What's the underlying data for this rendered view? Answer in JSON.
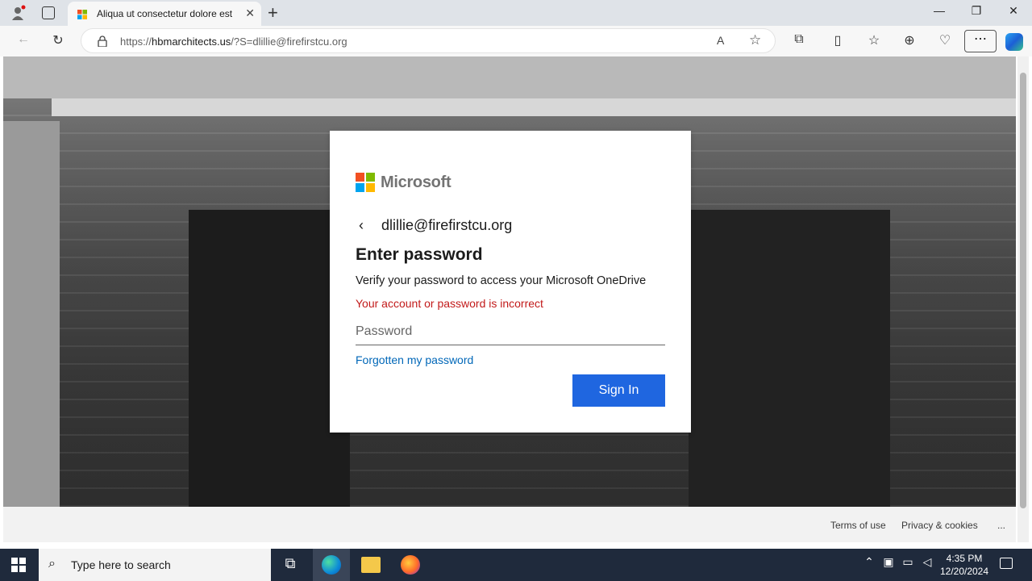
{
  "browser": {
    "tab_title": "Aliqua ut consectetur dolore est",
    "url_prefix": "https://",
    "url_host": "hbmarchitects.us",
    "url_rest": "/?S=dlillie@firefirstcu.org",
    "new_tab": "+",
    "tab_close": "✕",
    "window_controls": {
      "minimize": "—",
      "restore": "❐",
      "close": "✕"
    }
  },
  "dialog": {
    "brand": "Microsoft",
    "back_glyph": "‹",
    "email": "dlillie@firefirstcu.org",
    "heading": "Enter password",
    "description": "Verify your password to access your Microsoft OneDrive",
    "error": "Your account or password is incorrect",
    "password_placeholder": "Password",
    "forgot_link": "Forgotten my password",
    "sign_in": "Sign In"
  },
  "footer": {
    "terms": "Terms of use",
    "privacy": "Privacy & cookies",
    "more": "..."
  },
  "taskbar": {
    "search_placeholder": "Type here to search",
    "time": "4:35 PM",
    "date": "12/20/2024"
  },
  "colors": {
    "ms_red": "#f25022",
    "ms_green": "#7fba00",
    "ms_blue": "#00a4ef",
    "ms_yellow": "#ffb900",
    "error": "#c21a1a",
    "link": "#0067b8",
    "button": "#1f66e0"
  }
}
